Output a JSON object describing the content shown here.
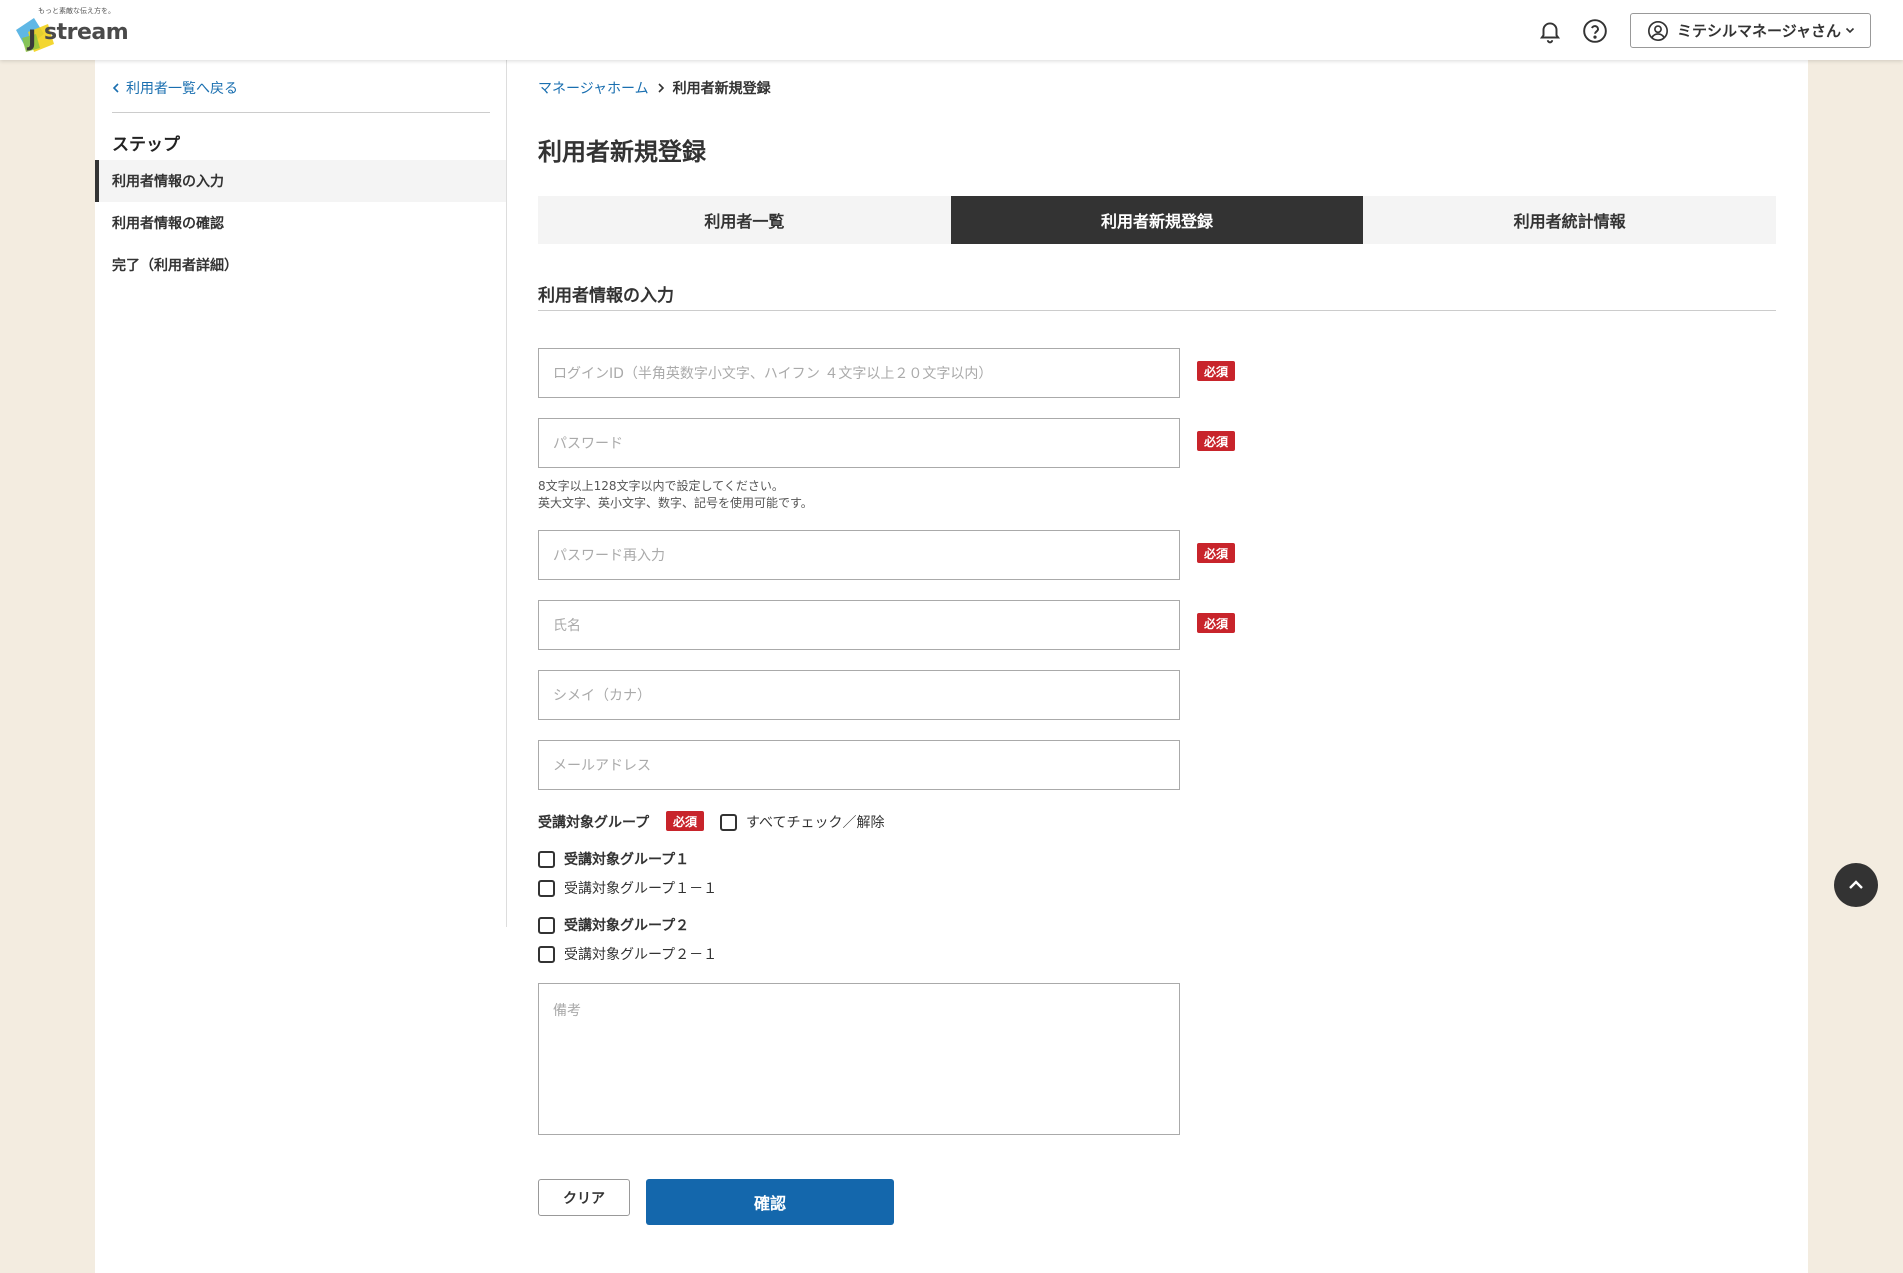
{
  "header": {
    "logo_tagline": "もっと素敵な伝え方を。",
    "logo_text": "stream",
    "logo_initial": "J",
    "user_name": "ミテシルマネージャさん",
    "icons": [
      "bell-icon",
      "help-icon",
      "user-icon",
      "chevron-down-icon"
    ]
  },
  "sidebar": {
    "back_label": "利用者一覧へ戻る",
    "steps_title": "ステップ",
    "steps": [
      {
        "label": "利用者情報の入力"
      },
      {
        "label": "利用者情報の確認"
      },
      {
        "label": "完了（利用者詳細）"
      }
    ]
  },
  "breadcrumb": {
    "home": "マネージャホーム",
    "current": "利用者新規登録"
  },
  "page_title": "利用者新規登録",
  "tabs": [
    {
      "label": "利用者一覧"
    },
    {
      "label": "利用者新規登録"
    },
    {
      "label": "利用者統計情報"
    }
  ],
  "section_title": "利用者情報の入力",
  "form": {
    "required_badge": "必須",
    "login_id": {
      "placeholder": "ログインID（半角英数字小文字、ハイフン ４文字以上２０文字以内）",
      "value": ""
    },
    "password": {
      "placeholder": "パスワード",
      "value": ""
    },
    "password_hint_1": "8文字以上128文字以内で設定してください。",
    "password_hint_2": "英大文字、英小文字、数字、記号を使用可能です。",
    "password_confirm": {
      "placeholder": "パスワード再入力",
      "value": ""
    },
    "name": {
      "placeholder": "氏名",
      "value": ""
    },
    "kana": {
      "placeholder": "シメイ（カナ）",
      "value": ""
    },
    "email": {
      "placeholder": "メールアドレス",
      "value": ""
    },
    "group_label": "受講対象グループ",
    "check_all": "すべてチェック／解除",
    "groups": [
      {
        "label": "受講対象グループ１"
      },
      {
        "label": "受講対象グループ１－１"
      },
      {
        "label": "受講対象グループ２"
      },
      {
        "label": "受講対象グループ２－１"
      }
    ],
    "notes": {
      "placeholder": "備考",
      "value": ""
    },
    "clear_label": "クリア",
    "confirm_label": "確認"
  },
  "colors": {
    "accent": "#1467ac",
    "required": "#c8242b",
    "active_tab": "#333333",
    "page_bg": "#f3ece0"
  }
}
